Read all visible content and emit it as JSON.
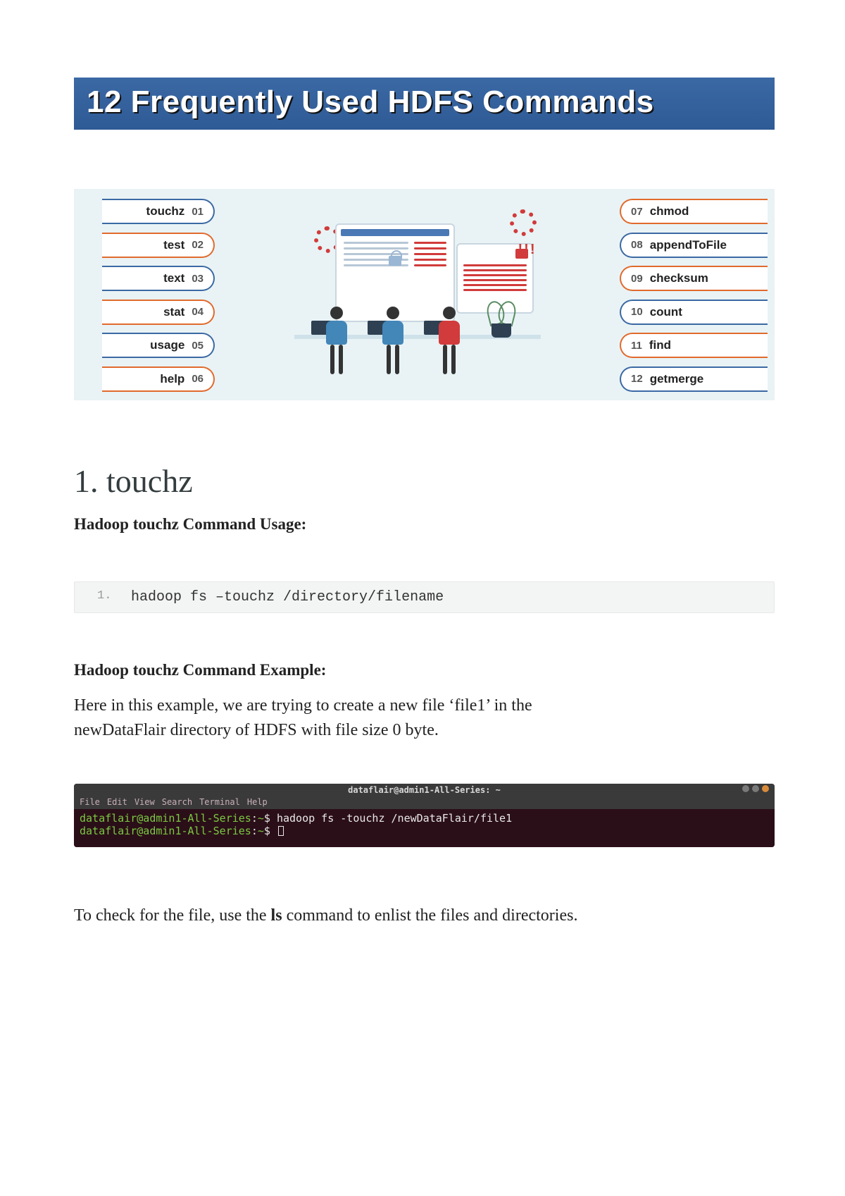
{
  "title": "12 Frequently Used HDFS Commands",
  "commands_left": [
    {
      "num": "01",
      "label": "touchz",
      "orange": false
    },
    {
      "num": "02",
      "label": "test",
      "orange": true
    },
    {
      "num": "03",
      "label": "text",
      "orange": false
    },
    {
      "num": "04",
      "label": "stat",
      "orange": true
    },
    {
      "num": "05",
      "label": "usage",
      "orange": false
    },
    {
      "num": "06",
      "label": "help",
      "orange": true
    }
  ],
  "commands_right": [
    {
      "num": "07",
      "label": "chmod",
      "orange": true
    },
    {
      "num": "08",
      "label": "appendToFile",
      "orange": false
    },
    {
      "num": "09",
      "label": "checksum",
      "orange": true
    },
    {
      "num": "10",
      "label": "count",
      "orange": false
    },
    {
      "num": "11",
      "label": "find",
      "orange": true
    },
    {
      "num": "12",
      "label": "getmerge",
      "orange": false
    }
  ],
  "illustration_alert": "!!!",
  "section_heading": "1. touchz",
  "usage_heading": "Hadoop touchz Command Usage:",
  "code_line_num": "1.",
  "code_text": "hadoop fs –touchz /directory/filename",
  "example_heading": "Hadoop touchz Command Example:",
  "example_text_a": "Here in this example, we are trying to create a new file ‘file1’ in the",
  "example_text_b": "newDataFlair directory of HDFS with file size 0 byte.",
  "terminal": {
    "title": "dataflair@admin1-All-Series: ~",
    "menu": [
      "File",
      "Edit",
      "View",
      "Search",
      "Terminal",
      "Help"
    ],
    "prompt_user": "dataflair@admin1-All-Series",
    "prompt_sep": ":",
    "prompt_path": "~",
    "prompt_dollar": "$",
    "cmd1": "hadoop fs -touchz /newDataFlair/file1"
  },
  "tail_a": "To check for the file, use the ",
  "tail_bold": "ls",
  "tail_b": " command to enlist the files and directories."
}
